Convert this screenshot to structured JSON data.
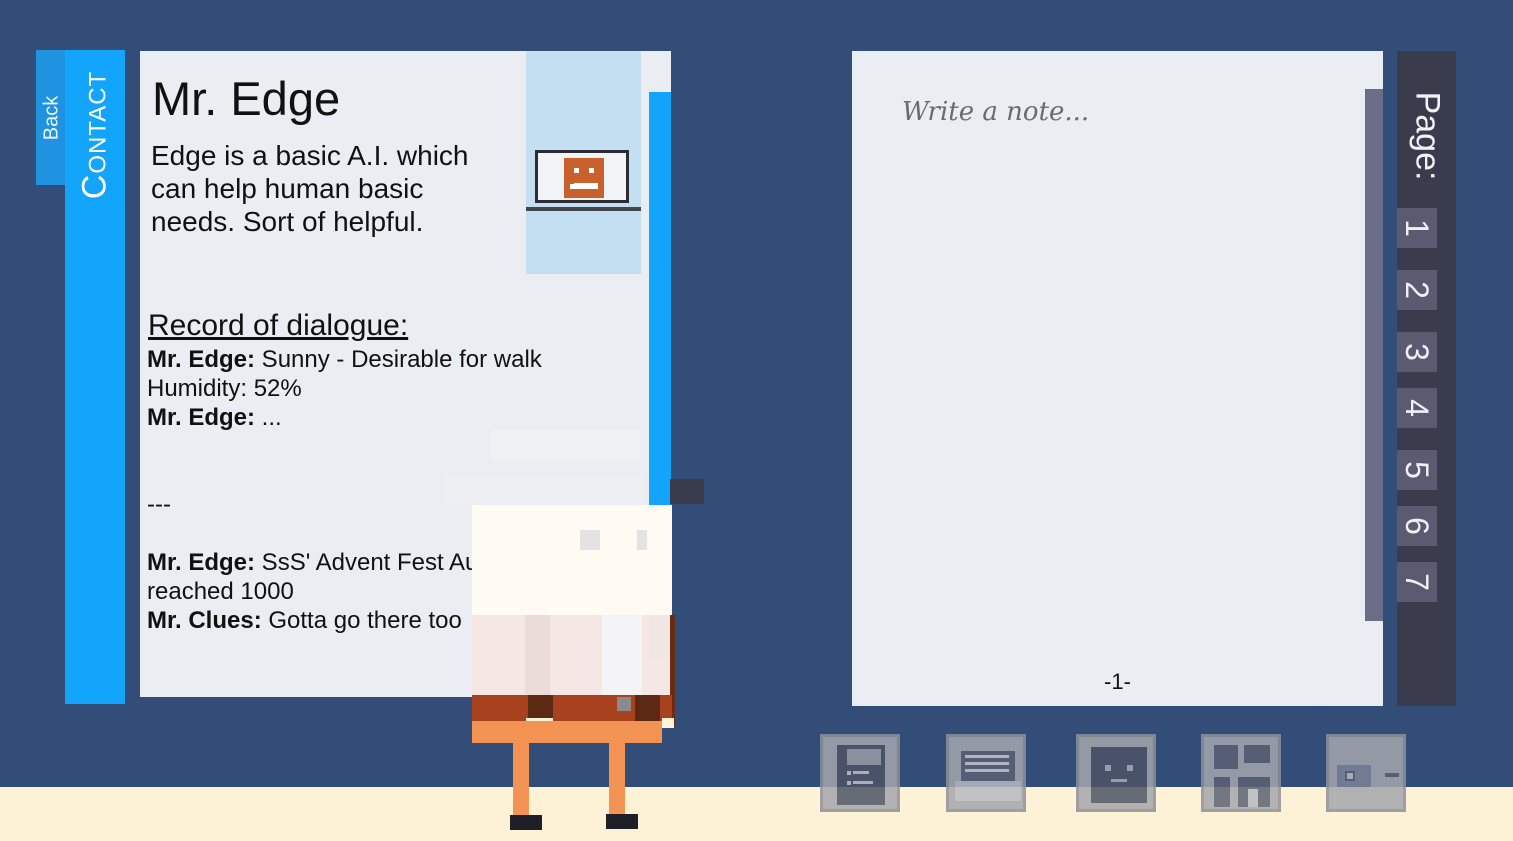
{
  "sidebar": {
    "back_label": "Back",
    "section_label": "Contact"
  },
  "contact": {
    "name": "Mr. Edge",
    "description": "Edge is a basic A.I. which can help human basic needs. Sort of helpful.",
    "portrait_icon": "laptop-robot-icon"
  },
  "dialogue": {
    "title": "Record of dialogue:",
    "entries": [
      {
        "speaker": "Mr. Edge:",
        "text": " Sunny - Desirable for walk"
      },
      {
        "speaker": "",
        "text": "Humidity: 52%"
      },
      {
        "speaker": "Mr. Edge:",
        "text": " ..."
      },
      {
        "speaker": "",
        "text": "---"
      },
      {
        "speaker": "Mr. Edge:",
        "text": " SsS' Advent Fest Audience has reached 1000"
      },
      {
        "speaker": "Mr. Clues:",
        "text": " Gotta go there too"
      }
    ]
  },
  "notes": {
    "placeholder": "Write a note...",
    "page_number": "-1-"
  },
  "pages": {
    "label": "Page:",
    "items": [
      "1",
      "2",
      "3",
      "4",
      "5",
      "6",
      "7"
    ]
  },
  "toolbar": {
    "items": [
      "notebook-icon",
      "document-icon",
      "face-icon",
      "map-icon",
      "id-card-icon"
    ]
  },
  "colors": {
    "background": "#324d78",
    "accent": "#12a5fb",
    "card": "#eaedf2",
    "page_strip": "#3a3b4d"
  }
}
